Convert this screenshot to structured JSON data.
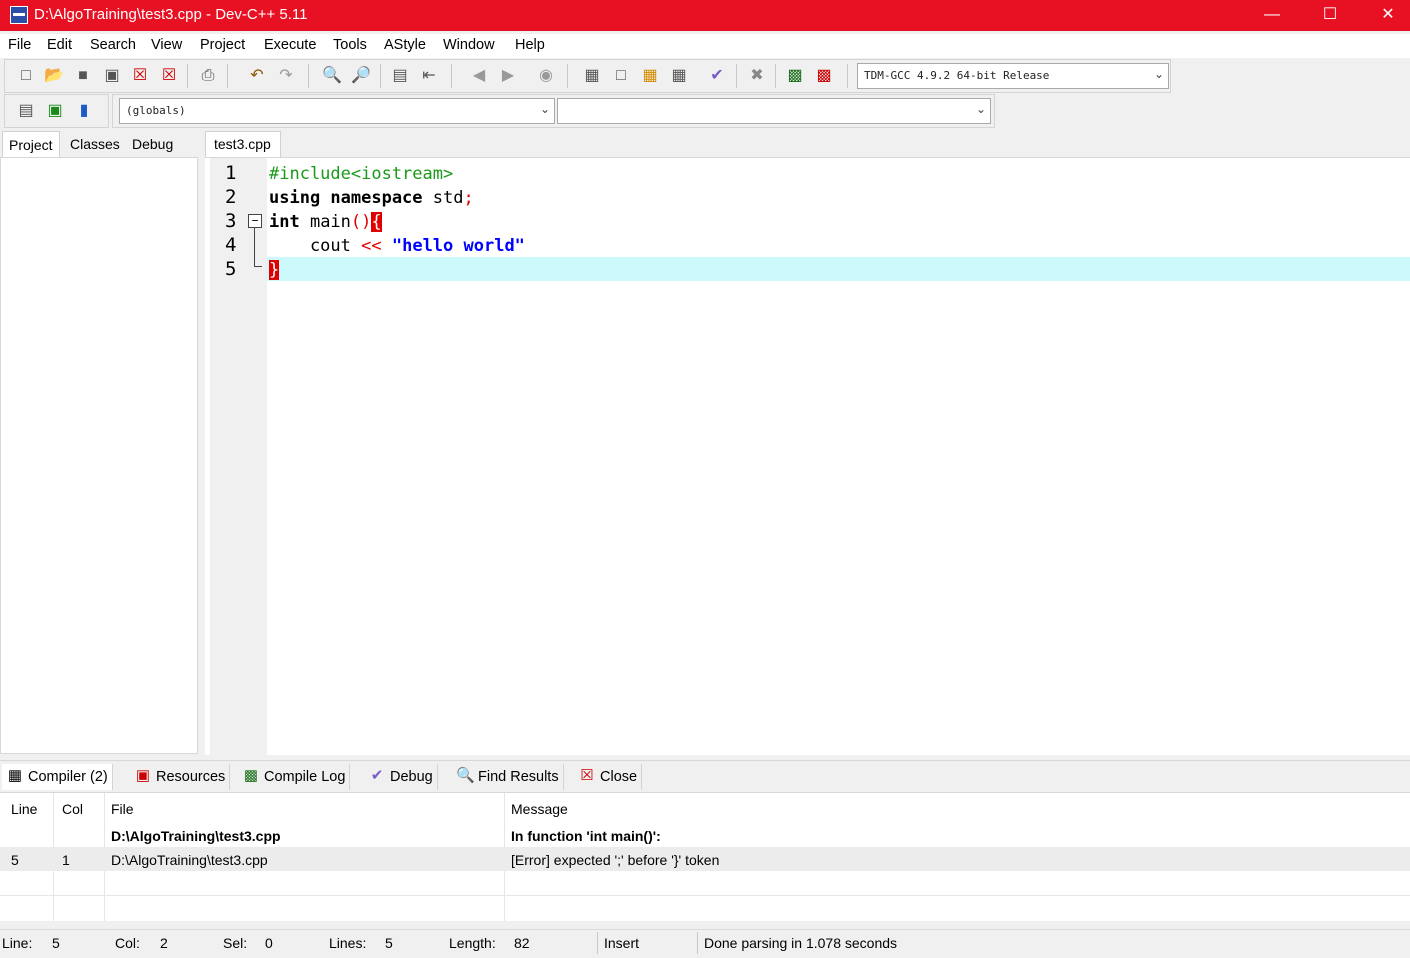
{
  "window": {
    "title": "D:\\AlgoTraining\\test3.cpp - Dev-C++ 5.11",
    "accent": "#e81123"
  },
  "menu": [
    "File",
    "Edit",
    "Search",
    "View",
    "Project",
    "Execute",
    "Tools",
    "AStyle",
    "Window",
    "Help"
  ],
  "toolbar": {
    "compiler_select": "TDM-GCC 4.9.2 64-bit Release",
    "scope_select": "(globals)",
    "member_select": "",
    "icons": [
      "new-file-icon",
      "open-file-icon",
      "save-icon",
      "save-all-icon",
      "close-file-icon",
      "close-all-icon",
      "print-icon",
      "undo-icon",
      "redo-icon",
      "find-icon",
      "replace-icon",
      "indent-icon",
      "unindent-icon",
      "bookmark-prev-icon",
      "bookmark-next-icon",
      "goto-line-icon",
      "compile-icon",
      "run-icon",
      "compile-run-icon",
      "rebuild-icon",
      "syntax-check-icon",
      "stop-icon",
      "profile-icon",
      "delete-profile-icon"
    ]
  },
  "left_tabs": [
    "Project",
    "Classes",
    "Debug"
  ],
  "editor": {
    "tab": "test3.cpp",
    "line_numbers": [
      "1",
      "2",
      "3",
      "4",
      "5"
    ],
    "highlight_color": "#ccfafc"
  },
  "bottom_tabs": [
    "Compiler (2)",
    "Resources",
    "Compile Log",
    "Debug",
    "Find Results",
    "Close"
  ],
  "messages": {
    "headers": {
      "line": "Line",
      "col": "Col",
      "file": "File",
      "message": "Message"
    },
    "rows": [
      {
        "line": "",
        "col": "",
        "file": "D:\\AlgoTraining\\test3.cpp",
        "message": "In function 'int main()':"
      },
      {
        "line": "5",
        "col": "1",
        "file": "D:\\AlgoTraining\\test3.cpp",
        "message": "[Error] expected ';' before '}' token"
      }
    ]
  },
  "status": {
    "line_label": "Line:",
    "line": "5",
    "col_label": "Col:",
    "col": "2",
    "sel_label": "Sel:",
    "sel": "0",
    "lines_label": "Lines:",
    "lines": "5",
    "length_label": "Length:",
    "length": "82",
    "mode": "Insert",
    "message": "Done parsing in 1.078 seconds"
  }
}
